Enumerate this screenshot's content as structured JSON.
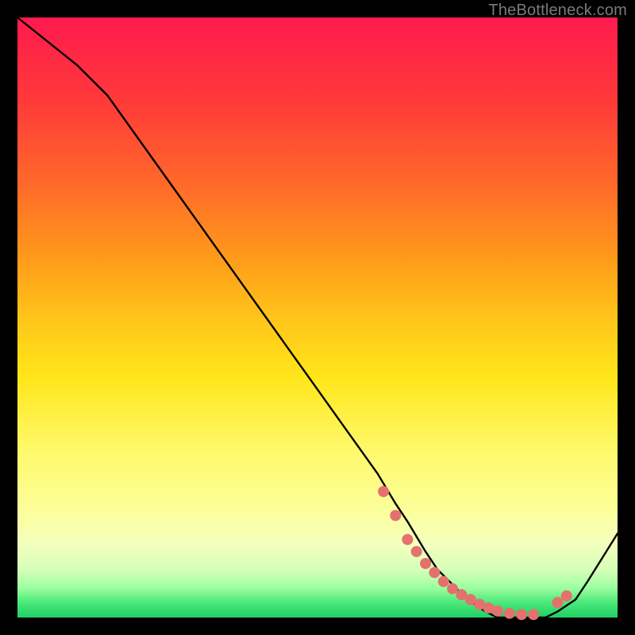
{
  "attribution": "TheBottleneck.com",
  "chart_data": {
    "type": "line",
    "title": "",
    "xlabel": "",
    "ylabel": "",
    "xlim": [
      0,
      100
    ],
    "ylim": [
      0,
      100
    ],
    "series": [
      {
        "name": "bottleneck-curve",
        "x": [
          0,
          5,
          10,
          15,
          20,
          25,
          30,
          35,
          40,
          45,
          50,
          55,
          60,
          63,
          65,
          68,
          70,
          73,
          75,
          78,
          80,
          83,
          85,
          88,
          90,
          93,
          95,
          100
        ],
        "y": [
          100,
          96,
          92,
          87,
          80,
          73,
          66,
          59,
          52,
          45,
          38,
          31,
          24,
          19,
          16,
          11,
          8,
          5,
          3,
          1,
          0,
          0,
          0,
          0,
          1,
          3,
          6,
          14
        ]
      }
    ],
    "markers": {
      "name": "highlight-points",
      "x": [
        61,
        63,
        65,
        66.5,
        68,
        69.5,
        71,
        72.5,
        74,
        75.5,
        77,
        78.5,
        80,
        82,
        84,
        86,
        90,
        91.5
      ],
      "y": [
        21,
        17,
        13,
        11,
        9,
        7.5,
        6,
        4.8,
        3.8,
        3,
        2.2,
        1.6,
        1.1,
        0.7,
        0.5,
        0.5,
        2.5,
        3.6
      ]
    }
  },
  "colors": {
    "curve": "#000000",
    "marker": "#e4716e"
  }
}
